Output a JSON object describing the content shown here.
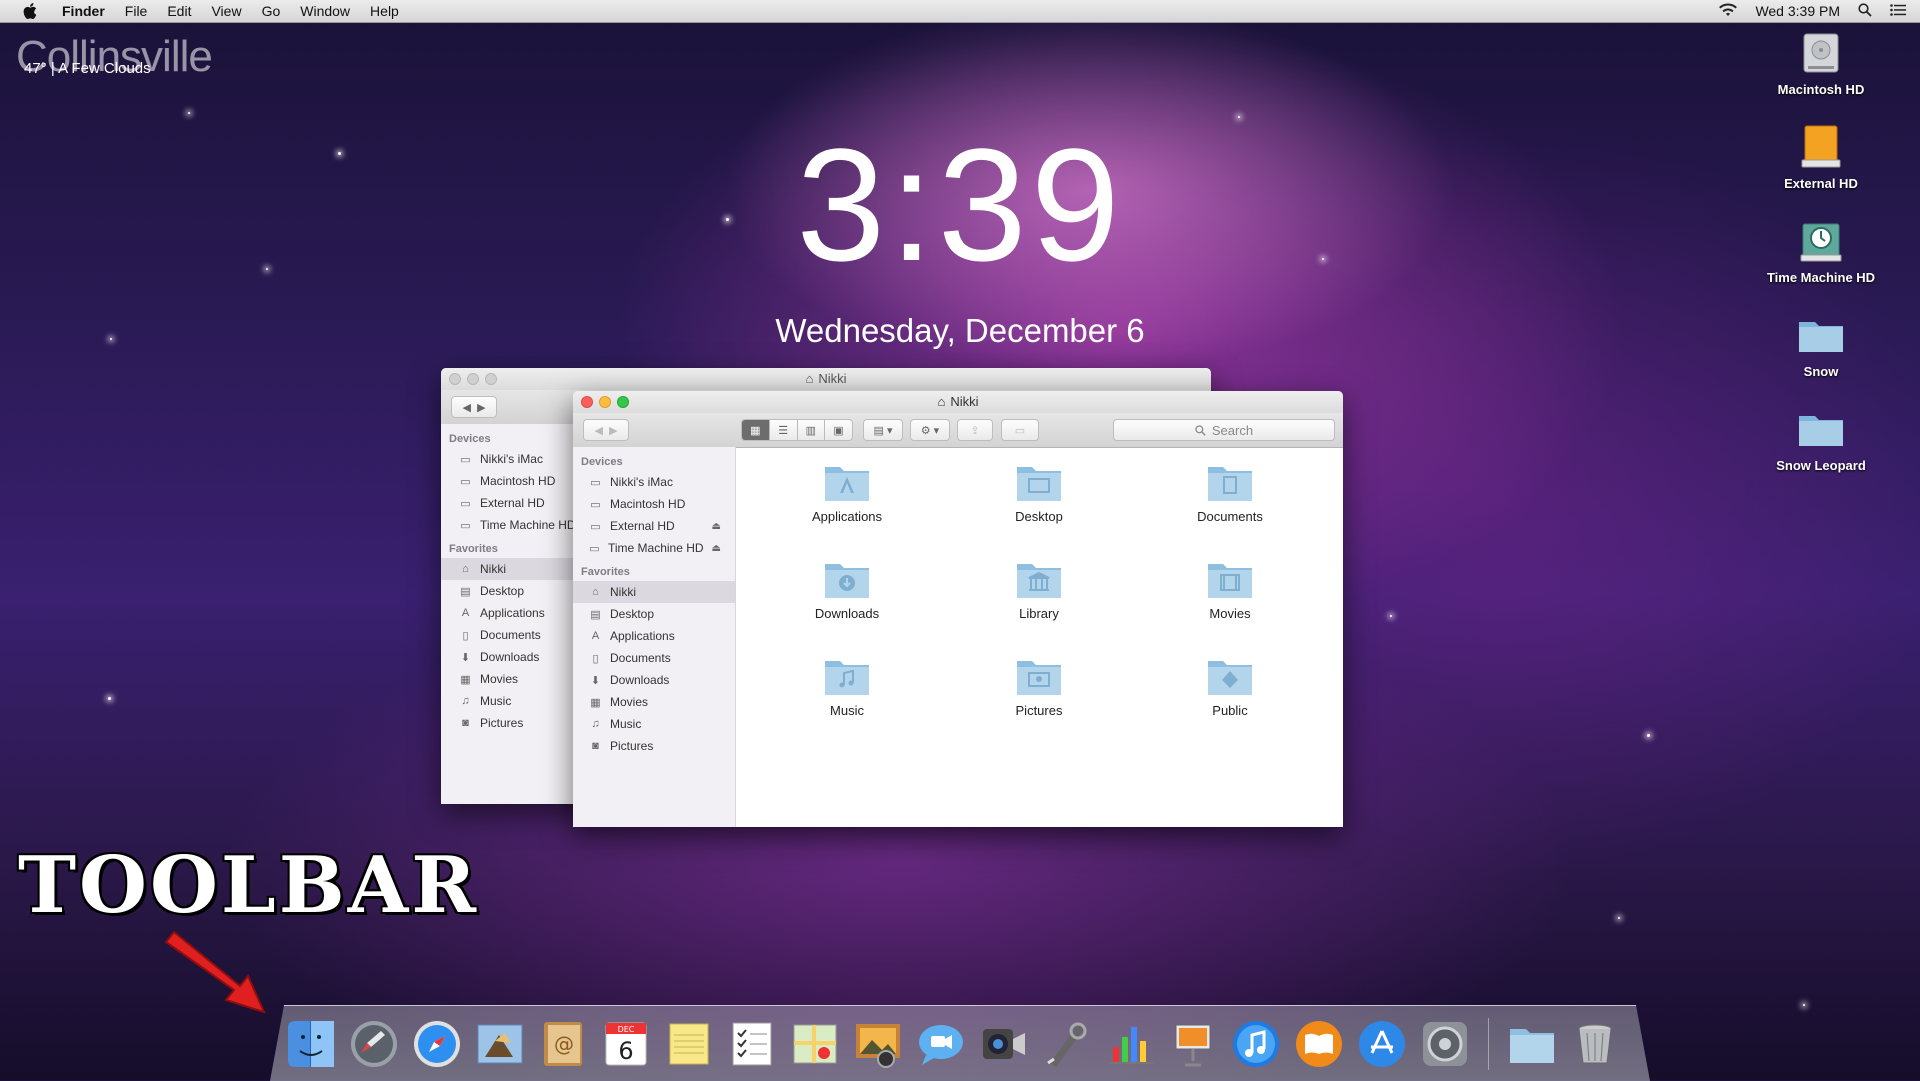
{
  "menubar": {
    "app_name": "Finder",
    "menus": [
      "File",
      "Edit",
      "View",
      "Go",
      "Window",
      "Help"
    ],
    "clock": "Wed 3:39 PM"
  },
  "weather": {
    "city": "Collinsville",
    "condition": "47° | A Few Clouds"
  },
  "lock_clock": {
    "time": "3:39",
    "date": "Wednesday, December 6"
  },
  "desktop_icons": [
    {
      "label": "Macintosh HD",
      "icon": "hard-drive-icon"
    },
    {
      "label": "External HD",
      "icon": "external-drive-icon"
    },
    {
      "label": "Time Machine HD",
      "icon": "time-machine-drive-icon"
    },
    {
      "label": "Snow",
      "icon": "folder-icon"
    },
    {
      "label": "Snow Leopard",
      "icon": "folder-icon"
    }
  ],
  "back_window": {
    "title": "Nikki",
    "devices_header": "Devices",
    "devices": [
      "Nikki's iMac",
      "Macintosh HD",
      "External HD",
      "Time Machine HD"
    ],
    "favorites_header": "Favorites",
    "favorites": [
      "Nikki",
      "Desktop",
      "Applications",
      "Documents",
      "Downloads",
      "Movies",
      "Music",
      "Pictures"
    ]
  },
  "front_window": {
    "title": "Nikki",
    "search_placeholder": "Search",
    "devices_header": "Devices",
    "devices": [
      "Nikki's iMac",
      "Macintosh HD",
      "External HD",
      "Time Machine HD"
    ],
    "favorites_header": "Favorites",
    "favorites": [
      "Nikki",
      "Desktop",
      "Applications",
      "Documents",
      "Downloads",
      "Movies",
      "Music",
      "Pictures"
    ],
    "selected_favorite": "Nikki",
    "folders": [
      "Applications",
      "Desktop",
      "Documents",
      "Downloads",
      "Library",
      "Movies",
      "Music",
      "Pictures",
      "Public"
    ]
  },
  "annotation": {
    "label": "TOOLBAR"
  },
  "dock": {
    "calendar_month": "DEC",
    "calendar_day": "6",
    "items": [
      "finder-icon",
      "launchpad-icon",
      "safari-icon",
      "mail-icon",
      "contacts-icon",
      "calendar-icon",
      "notes-icon",
      "reminders-icon",
      "maps-icon",
      "photo-booth-icon",
      "messages-icon",
      "facetime-icon",
      "preview-icon",
      "numbers-icon",
      "keynote-icon",
      "itunes-icon",
      "ibooks-icon",
      "app-store-icon",
      "system-preferences-icon",
      "folder-icon",
      "trash-icon"
    ]
  },
  "colors": {
    "accent_red": "#e02020",
    "folder_blue": "#a8cde6",
    "window_bg": "#ffffff",
    "sidebar_bg": "#f2f0f4"
  }
}
